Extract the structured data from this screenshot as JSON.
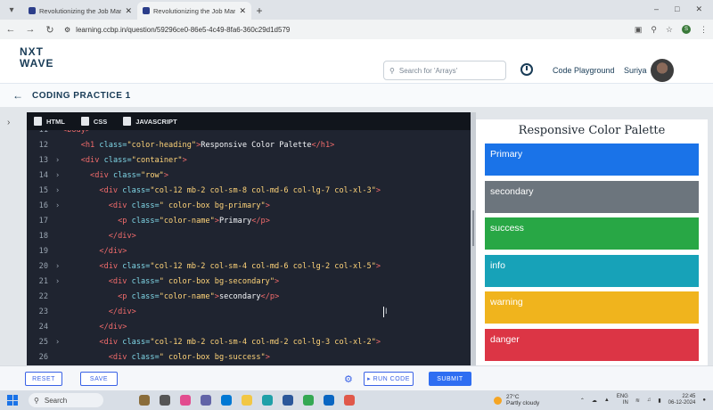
{
  "browser": {
    "tabs": [
      {
        "title": "Revolutionizing the Job Market",
        "active": false
      },
      {
        "title": "Revolutionizing the Job Market",
        "active": true
      }
    ],
    "url": "learning.ccbp.in/question/59296ce0-86e5-4c49-8fa6-360c29d1d579"
  },
  "header": {
    "logo_line1": "NXT",
    "logo_line2": "WAVE",
    "search_placeholder": "Search for 'Arrays'",
    "code_playground": "Code Playground",
    "user_name": "Suriya"
  },
  "practice": {
    "title": "CODING PRACTICE 1"
  },
  "editor": {
    "file_tabs": [
      "HTML",
      "CSS",
      "JAVASCRIPT"
    ],
    "lines": [
      {
        "num": "11",
        "fold": false,
        "html": "<span class=\"tg\">&lt;body&gt;</span>"
      },
      {
        "num": "12",
        "fold": false,
        "html": "    <span class=\"tg\">&lt;h1</span> <span class=\"at\">class=</span><span class=\"st\">\"color-heading\"</span><span class=\"tg\">&gt;</span><span class=\"tx\">Responsive Color Palette</span><span class=\"tg\">&lt;/h1&gt;</span>"
      },
      {
        "num": "13",
        "fold": true,
        "html": "    <span class=\"tg\">&lt;div</span> <span class=\"at\">class=</span><span class=\"st\">\"container\"</span><span class=\"tg\">&gt;</span>"
      },
      {
        "num": "14",
        "fold": true,
        "html": "      <span class=\"tg\">&lt;div</span> <span class=\"at\">class=</span><span class=\"st\">\"row\"</span><span class=\"tg\">&gt;</span>"
      },
      {
        "num": "15",
        "fold": true,
        "html": "        <span class=\"tg\">&lt;div</span> <span class=\"at\">class=</span><span class=\"st\">\"col-12 mb-2 col-sm-8 col-md-6 col-lg-7 col-xl-3\"</span><span class=\"tg\">&gt;</span>"
      },
      {
        "num": "16",
        "fold": true,
        "html": "          <span class=\"tg\">&lt;div</span> <span class=\"at\">class=</span><span class=\"st\">\" color-box bg-primary\"</span><span class=\"tg\">&gt;</span>"
      },
      {
        "num": "17",
        "fold": false,
        "html": "            <span class=\"tg\">&lt;p</span> <span class=\"at\">class=</span><span class=\"st\">\"color-name\"</span><span class=\"tg\">&gt;</span><span class=\"tx\">Primary</span><span class=\"tg\">&lt;/p&gt;</span>"
      },
      {
        "num": "18",
        "fold": false,
        "html": "          <span class=\"tg\">&lt;/div&gt;</span>"
      },
      {
        "num": "19",
        "fold": false,
        "html": "        <span class=\"tg\">&lt;/div&gt;</span>"
      },
      {
        "num": "20",
        "fold": true,
        "html": "        <span class=\"tg\">&lt;div</span> <span class=\"at\">class=</span><span class=\"st\">\"col-12 mb-2 col-sm-4 col-md-6 col-lg-2 col-xl-5\"</span><span class=\"tg\">&gt;</span>"
      },
      {
        "num": "21",
        "fold": true,
        "html": "          <span class=\"tg\">&lt;div</span> <span class=\"at\">class=</span><span class=\"st\">\" color-box bg-secondary\"</span><span class=\"tg\">&gt;</span>"
      },
      {
        "num": "22",
        "fold": false,
        "html": "            <span class=\"tg\">&lt;p</span> <span class=\"at\">class=</span><span class=\"st\">\"color-name\"</span><span class=\"tg\">&gt;</span><span class=\"tx\">secondary</span><span class=\"tg\">&lt;/p&gt;</span>"
      },
      {
        "num": "23",
        "fold": false,
        "html": "          <span class=\"tg\">&lt;/div&gt;</span>"
      },
      {
        "num": "24",
        "fold": false,
        "html": "        <span class=\"tg\">&lt;/div&gt;</span>"
      },
      {
        "num": "25",
        "fold": true,
        "html": "        <span class=\"tg\">&lt;div</span> <span class=\"at\">class=</span><span class=\"st\">\"col-12 mb-2 col-sm-4 col-md-2 col-lg-3 col-xl-2\"</span><span class=\"tg\">&gt;</span>"
      },
      {
        "num": "26",
        "fold": false,
        "html": "          <span class=\"tg\">&lt;div</span> <span class=\"at\">class=</span><span class=\"st\">\" color-box bg-success\"</span><span class=\"tg\">&gt;</span>"
      }
    ]
  },
  "preview": {
    "heading": "Responsive Color Palette",
    "swatches": [
      {
        "label": "Primary",
        "color": "#1a73e8"
      },
      {
        "label": "secondary",
        "color": "#6c757d"
      },
      {
        "label": "success",
        "color": "#28a745"
      },
      {
        "label": "info",
        "color": "#17a2b8"
      },
      {
        "label": "warning",
        "color": "#f0b41d"
      },
      {
        "label": "danger",
        "color": "#dc3545"
      }
    ]
  },
  "actions": {
    "reset": "RESET",
    "save": "SAVE",
    "run_code": "RUN CODE",
    "submit": "SUBMIT"
  },
  "taskbar": {
    "search": "Search",
    "temperature": "27°C",
    "weather": "Partly cloudy",
    "language": "ENG",
    "region": "IN",
    "time": "22:45",
    "date": "06-12-2024"
  }
}
